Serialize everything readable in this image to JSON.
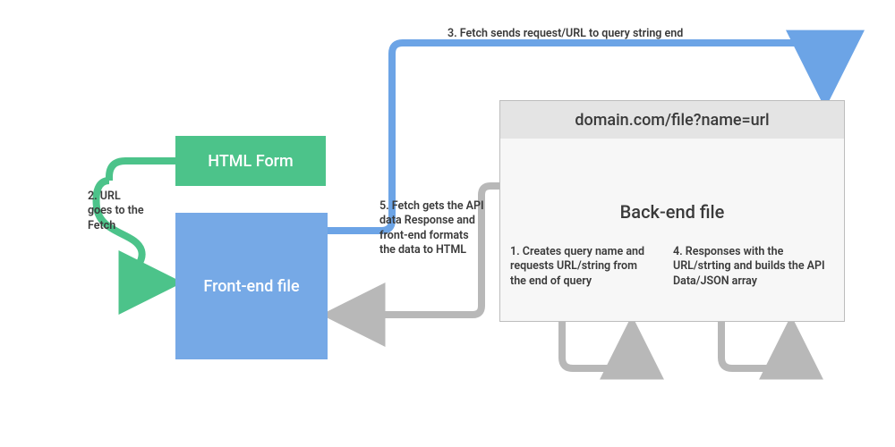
{
  "boxes": {
    "html_form": "HTML Form",
    "front_end": "Front-end file",
    "back_end_label": "Back-end file",
    "url_bar": "domain.com/file?name=url"
  },
  "captions": {
    "step2": "2. URL goes to the Fetch",
    "step3": "3. Fetch sends request/URL to query string end",
    "step5": "5. Fetch gets the API data Response and front-end formats the data to HTML",
    "step1": "1.  Creates query name and requests URL/string from the end of query",
    "step4": "4. Responses with the URL/strting and builds the API Data/JSON array"
  },
  "colors": {
    "green": "#4CC38A",
    "blue_box": "#76A9E6",
    "blue_arrow": "#6CA4E6",
    "gray": "#B8B8B8"
  },
  "diagram": {
    "nodes": [
      {
        "id": "html_form",
        "label": "HTML Form"
      },
      {
        "id": "front_end",
        "label": "Front-end file"
      },
      {
        "id": "back_end",
        "label": "Back-end file",
        "url": "domain.com/file?name=url"
      }
    ],
    "edges": [
      {
        "from": "html_form",
        "to": "front_end",
        "label": "2. URL goes to the Fetch",
        "color": "green"
      },
      {
        "from": "front_end",
        "to": "back_end",
        "label": "3. Fetch sends request/URL to query string end",
        "color": "blue"
      },
      {
        "from": "back_end",
        "intra": true,
        "label": "1. Creates query name and requests URL/string from the end of query",
        "color": "gray"
      },
      {
        "from": "back_end",
        "intra": true,
        "label": "4. Responses with the URL/strting and builds the API Data/JSON array",
        "color": "gray"
      },
      {
        "from": "back_end",
        "to": "front_end",
        "label": "5. Fetch gets the API data Response and front-end formats the data to HTML",
        "color": "gray"
      }
    ]
  }
}
